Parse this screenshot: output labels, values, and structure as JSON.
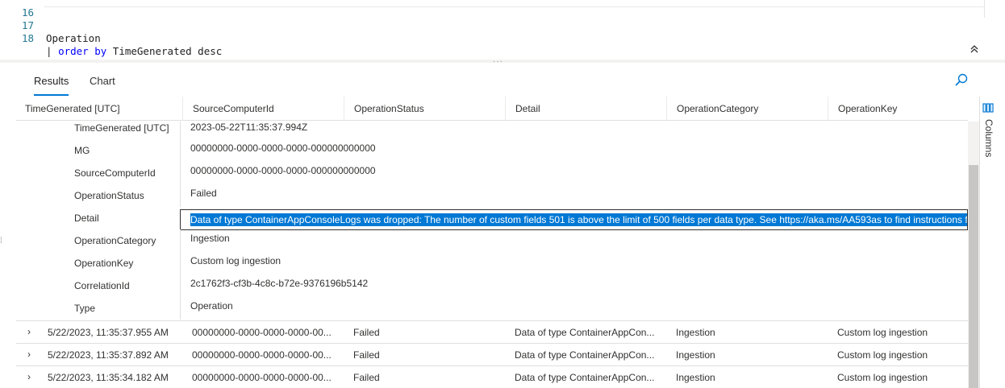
{
  "editor": {
    "lines": [
      {
        "number": "16",
        "code": ""
      },
      {
        "number": "17",
        "code": "Operation"
      },
      {
        "number": "18",
        "pipe": "| ",
        "keyword": "order by",
        "rest": " TimeGenerated desc"
      }
    ]
  },
  "tabs": {
    "results": "Results",
    "chart": "Chart"
  },
  "grid": {
    "columns": [
      "TimeGenerated [UTC]",
      "SourceComputerId",
      "OperationStatus",
      "Detail",
      "OperationCategory",
      "OperationKey"
    ],
    "expanded_details": [
      {
        "key": "TimeGenerated [UTC]",
        "value": "2023-05-22T11:35:37.994Z"
      },
      {
        "key": "MG",
        "value": "00000000-0000-0000-0000-000000000000"
      },
      {
        "key": "SourceComputerId",
        "value": "00000000-0000-0000-0000-000000000000"
      },
      {
        "key": "OperationStatus",
        "value": "Failed"
      },
      {
        "key": "Detail",
        "value": "Data of type ContainerAppConsoleLogs was dropped: The number of custom fields 501 is above the limit of 500 fields per data type. See https://aka.ms/AA593as to find instructions fo"
      },
      {
        "key": "OperationCategory",
        "value": "Ingestion"
      },
      {
        "key": "OperationKey",
        "value": "Custom log ingestion"
      },
      {
        "key": "CorrelationId",
        "value": "2c1762f3-cf3b-4c8c-b72e-9376196b5142"
      },
      {
        "key": "Type",
        "value": "Operation"
      }
    ],
    "rows": [
      {
        "time": "5/22/2023, 11:35:37.955 AM",
        "source": "00000000-0000-0000-0000-00...",
        "status": "Failed",
        "detail": "Data of type ContainerAppCon...",
        "category": "Ingestion",
        "key": "Custom log ingestion"
      },
      {
        "time": "5/22/2023, 11:35:37.892 AM",
        "source": "00000000-0000-0000-0000-00...",
        "status": "Failed",
        "detail": "Data of type ContainerAppCon...",
        "category": "Ingestion",
        "key": "Custom log ingestion"
      },
      {
        "time": "5/22/2023, 11:35:34.182 AM",
        "source": "00000000-0000-0000-0000-00...",
        "status": "Failed",
        "detail": "Data of type ContainerAppCon...",
        "category": "Ingestion",
        "key": "Custom log ingestion"
      }
    ]
  },
  "side_panel": {
    "columns_label": "Columns"
  },
  "colors": {
    "accent": "#0078d4",
    "line_number": "#237893",
    "keyword": "#0000ff"
  },
  "icons": {
    "search": "search-icon",
    "collapse": "chevron-double-up-icon",
    "expander": "chevron-right-icon",
    "columns": "columns-icon"
  }
}
